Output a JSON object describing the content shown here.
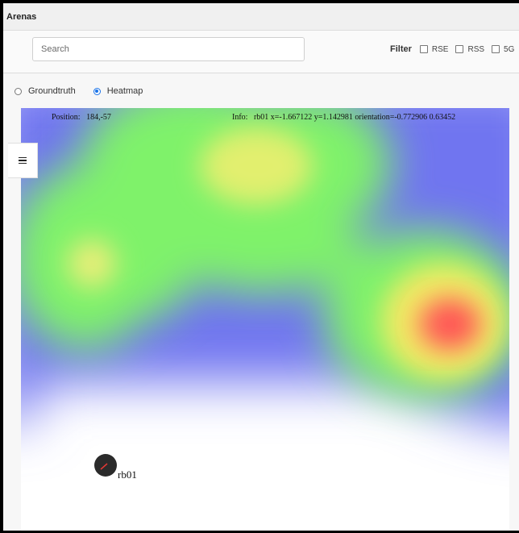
{
  "window": {
    "title": "Arenas"
  },
  "search": {
    "placeholder": "Search",
    "value": ""
  },
  "filter": {
    "label": "Filter",
    "options": [
      {
        "label": "RSE",
        "checked": false
      },
      {
        "label": "RSS",
        "checked": false
      },
      {
        "label": "5G",
        "checked": false
      }
    ]
  },
  "view_mode": {
    "options": [
      {
        "label": "Groundtruth",
        "selected": false
      },
      {
        "label": "Heatmap",
        "selected": true
      }
    ]
  },
  "map": {
    "position_label": "Position:",
    "position_value": "184,-57",
    "info_label": "Info:",
    "info_value": "rb01 x=-1.667122 y=1.142981 orientation=-0.772906 0.63452",
    "robot_name": "rb01",
    "robot_color": "#2b2b2b",
    "robot_heading_color": "#e53935",
    "heatmap_colors": [
      "#6f74f0",
      "#7ff26a",
      "#e2ef6e",
      "#ff5a5a"
    ]
  },
  "menu": {
    "icon": "hamburger-icon"
  }
}
